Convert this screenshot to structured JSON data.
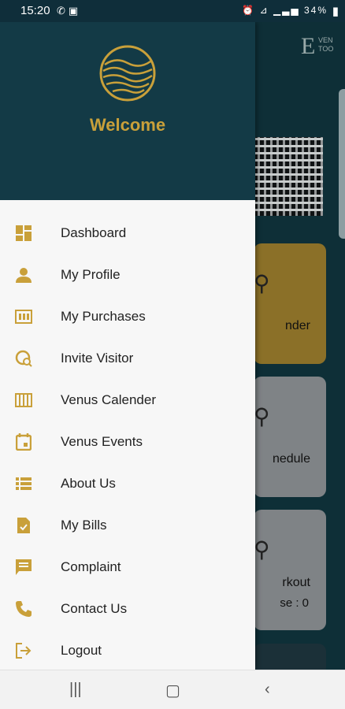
{
  "status_bar": {
    "time": "15:20",
    "notification_icons": [
      "whatsapp-icon",
      "message-icon"
    ],
    "system_icons": [
      "alarm-icon",
      "wifi-icon",
      "signal-icon"
    ],
    "battery": "34%"
  },
  "drawer": {
    "header": {
      "welcome": "Welcome"
    },
    "items": [
      {
        "label": "Dashboard",
        "icon": "dashboard-icon"
      },
      {
        "label": "My Profile",
        "icon": "person-icon"
      },
      {
        "label": "My Purchases",
        "icon": "purchases-icon"
      },
      {
        "label": "Invite Visitor",
        "icon": "invite-icon"
      },
      {
        "label": "Venus Calender",
        "icon": "calendar-grid-icon"
      },
      {
        "label": "Venus Events",
        "icon": "event-icon"
      },
      {
        "label": "About Us",
        "icon": "list-icon"
      },
      {
        "label": "My Bills",
        "icon": "bill-icon"
      },
      {
        "label": "Complaint",
        "icon": "complaint-icon"
      },
      {
        "label": "Contact Us",
        "icon": "phone-icon"
      },
      {
        "label": "Logout",
        "icon": "logout-icon"
      }
    ]
  },
  "background": {
    "logo_text": "VEN TOO",
    "tiles": [
      {
        "label": "nder"
      },
      {
        "label": "nedule"
      },
      {
        "label": "rkout",
        "sub": "se : 0"
      }
    ]
  },
  "colors": {
    "drawer_header_bg": "#133a46",
    "accent_gold": "#c9a03a",
    "drawer_bg": "#f7f7f7"
  }
}
